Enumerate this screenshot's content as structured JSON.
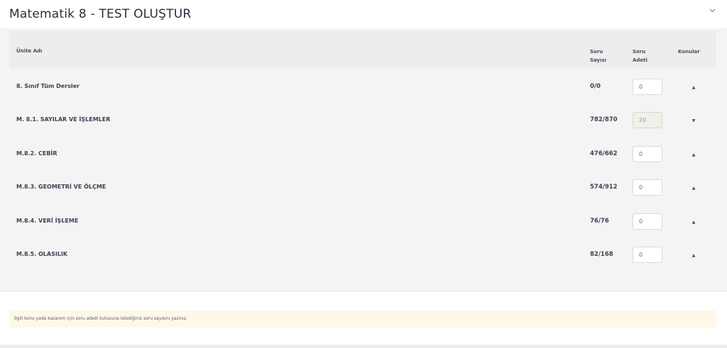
{
  "header": {
    "title": "Matematik 8 - TEST OLUŞTUR",
    "collapse_icon": "chevron-down-icon"
  },
  "table": {
    "columns": {
      "unit": "Ünite Adı",
      "question_count_line1": "Soru",
      "question_count_line2": "Sayısı",
      "question_qty_line1": "Soru",
      "question_qty_line2": "Adeti",
      "topics": "Konular"
    },
    "rows": [
      {
        "name": "8. Sınıf Tüm Dersler",
        "count": "0/0",
        "qty": "0",
        "qty_disabled": false,
        "caret": "▲"
      },
      {
        "name": "M. 8.1. SAYILAR VE İŞLEMLER",
        "count": "782/870",
        "qty": "20",
        "qty_disabled": true,
        "caret": "▼"
      },
      {
        "name": "M.8.2. CEBİR",
        "count": "476/662",
        "qty": "0",
        "qty_disabled": false,
        "caret": "▲"
      },
      {
        "name": "M.8.3. GEOMETRİ VE ÖLÇME",
        "count": "574/912",
        "qty": "0",
        "qty_disabled": false,
        "caret": "▲"
      },
      {
        "name": "M.8.4. VERİ İŞLEME",
        "count": "76/76",
        "qty": "0",
        "qty_disabled": false,
        "caret": "▲"
      },
      {
        "name": "M.8.5. OLASILIK",
        "count": "82/168",
        "qty": "0",
        "qty_disabled": false,
        "caret": "▲"
      }
    ]
  },
  "notice": {
    "text": "İlgili konu yada kazanım için soru adedi kutusuna istediğiniz soru sayısını yazınız."
  },
  "colors": {
    "panel_bg": "#f4f4f4",
    "header_row_bg": "#ededed",
    "notice_bg": "#fdf8e8",
    "disabled_input_bg": "#eef0ea"
  }
}
